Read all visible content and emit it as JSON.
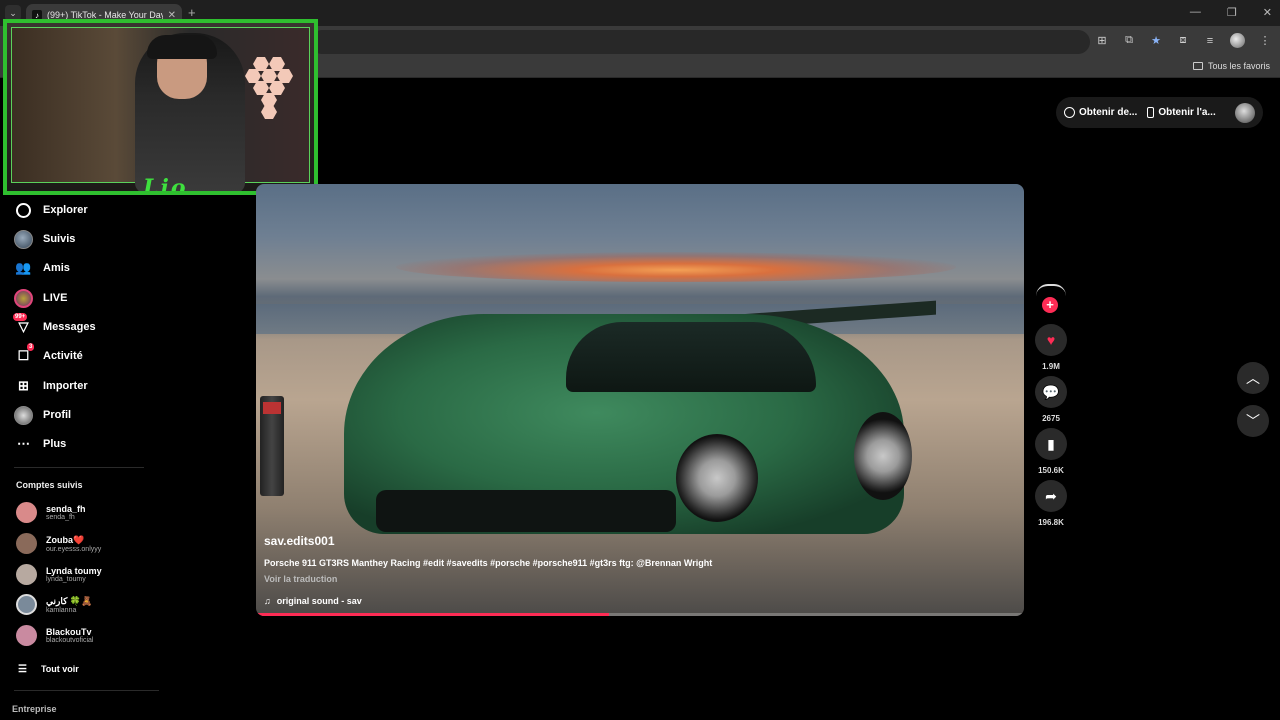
{
  "browser": {
    "tab_title": "(99+) TikTok - Make Your Day",
    "tab_favicon": "tiktok-icon",
    "new_tab": "+",
    "bookmark_folder": "Tous les favoris"
  },
  "top_pill": {
    "get_coins": "Obtenir de...",
    "get_app": "Obtenir l'a..."
  },
  "webcam": {
    "overlay_signature": "Lio"
  },
  "sidebar": {
    "items": [
      {
        "label": "Explorer",
        "icon": "compass-icon"
      },
      {
        "label": "Suivis",
        "icon": "following-avatar-icon"
      },
      {
        "label": "Amis",
        "icon": "friends-icon"
      },
      {
        "label": "LIVE",
        "icon": "live-icon"
      },
      {
        "label": "Messages",
        "icon": "messages-icon",
        "badge": "99+"
      },
      {
        "label": "Activité",
        "icon": "activity-icon",
        "badge": "3"
      },
      {
        "label": "Importer",
        "icon": "upload-icon"
      },
      {
        "label": "Profil",
        "icon": "profile-avatar-icon"
      },
      {
        "label": "Plus",
        "icon": "more-icon"
      }
    ],
    "following_title": "Comptes suivis",
    "following": [
      {
        "name": "senda_fh",
        "handle": "senda_fh",
        "color": "#d98a8a"
      },
      {
        "name": "Zouba❤️",
        "handle": "our.eyesss.onlyyy",
        "color": "#8a6a5a"
      },
      {
        "name": "Lynda toumy",
        "handle": "lynda_toumy",
        "color": "#b7a9a0"
      },
      {
        "name": "كارني 🍀🧸",
        "handle": "kamlanna",
        "color": "#7a8a9a"
      },
      {
        "name": "BlackouTv",
        "handle": "blackoutvoficial",
        "color": "#c98aa0"
      }
    ],
    "see_all": "Tout voir",
    "footer_title": "Entreprise"
  },
  "video": {
    "username": "sav.edits001",
    "description": "Porsche 911 GT3RS Manthey Racing #edit #savedits #porsche #porsche911 #gt3rs ftg: @Brennan Wright",
    "translate": "Voir la traduction",
    "sound": "original sound - sav",
    "progress": 0.46
  },
  "actions": {
    "likes": "1.9M",
    "comments": "2675",
    "saves": "150.6K",
    "shares": "196.8K"
  },
  "colors": {
    "accent": "#fe2c55",
    "webcam_border": "#2fbf2f"
  }
}
